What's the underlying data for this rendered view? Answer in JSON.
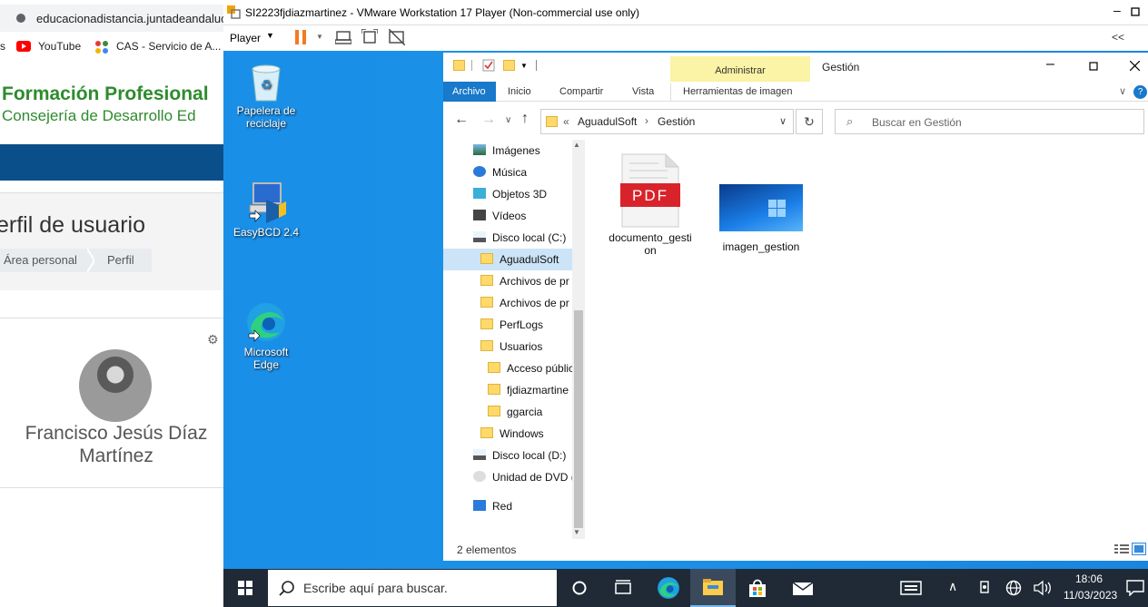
{
  "browser": {
    "url": "educacionadistancia.juntadeandalucia.es",
    "bookmarks": [
      "YouTube",
      "CAS - Servicio de A..."
    ],
    "site_title": "Formación Profesional",
    "site_subtitle": "Consejería de Desarrollo Ed",
    "page_title": "erfil de usuario",
    "breadcrumb": [
      "Área personal",
      "Perfil"
    ],
    "user_name": "Francisco Jesús Díaz Martínez"
  },
  "vmware": {
    "window_title": "SI2223fjdiazmartinez - VMware Workstation 17 Player (Non-commercial use only)",
    "player_menu": "Player",
    "collapse": "<<"
  },
  "desktop_icons": [
    {
      "label": "Papelera de reciclaje",
      "icon": "recycle-bin-icon"
    },
    {
      "label": "EasyBCD 2.4",
      "icon": "easybcd-icon"
    },
    {
      "label": "Microsoft Edge",
      "icon": "edge-icon"
    }
  ],
  "explorer": {
    "title": "Gestión",
    "context_tab": "Administrar",
    "tabs": [
      "Archivo",
      "Inicio",
      "Compartir",
      "Vista",
      "Herramientas de imagen"
    ],
    "path": [
      "AguadulSoft",
      "Gestión"
    ],
    "path_prefix": "«",
    "search_placeholder": "Buscar en Gestión",
    "nav_items": [
      {
        "label": "Imágenes",
        "icon": "pictures-icon",
        "indent": 0
      },
      {
        "label": "Música",
        "icon": "music-icon",
        "indent": 0
      },
      {
        "label": "Objetos 3D",
        "icon": "3d-objects-icon",
        "indent": 0
      },
      {
        "label": "Vídeos",
        "icon": "videos-icon",
        "indent": 0
      },
      {
        "label": "Disco local (C:)",
        "icon": "drive-icon",
        "indent": 0
      },
      {
        "label": "AguadulSoft",
        "icon": "folder-icon",
        "indent": 1,
        "selected": true
      },
      {
        "label": "Archivos de pr",
        "icon": "folder-icon",
        "indent": 1
      },
      {
        "label": "Archivos de pr",
        "icon": "folder-icon",
        "indent": 1
      },
      {
        "label": "PerfLogs",
        "icon": "folder-icon",
        "indent": 1
      },
      {
        "label": "Usuarios",
        "icon": "folder-icon",
        "indent": 1
      },
      {
        "label": "Acceso públic",
        "icon": "folder-icon",
        "indent": 2
      },
      {
        "label": "fjdiazmartine",
        "icon": "folder-icon",
        "indent": 2
      },
      {
        "label": "ggarcia",
        "icon": "folder-icon",
        "indent": 2
      },
      {
        "label": "Windows",
        "icon": "folder-icon",
        "indent": 1
      },
      {
        "label": "Disco local (D:)",
        "icon": "drive-icon",
        "indent": 0
      },
      {
        "label": "Unidad de DVD (",
        "icon": "dvd-icon",
        "indent": 0
      },
      {
        "label": "Red",
        "icon": "network-icon",
        "indent": 0
      }
    ],
    "files": [
      {
        "name": "documento_gestion",
        "type": "pdf",
        "badge": "PDF"
      },
      {
        "name": "imagen_gestion",
        "type": "image"
      }
    ],
    "status": "2 elementos"
  },
  "taskbar": {
    "search_placeholder": "Escribe aquí para buscar.",
    "time": "18:06",
    "date": "11/03/2023"
  },
  "colors": {
    "desktop": "#1a8fe8",
    "taskbar": "#1f2a36",
    "accent": "#1979ca",
    "admin_tab": "#fbf3a5",
    "fp_green": "#2e8b2e"
  }
}
